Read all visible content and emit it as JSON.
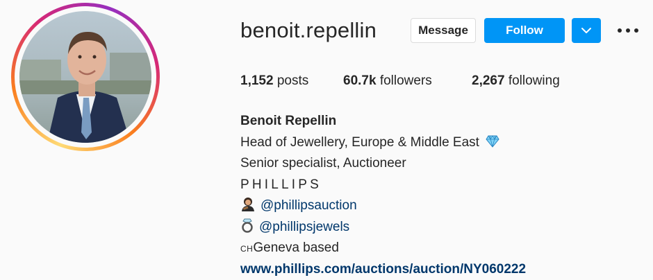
{
  "profile": {
    "username": "benoit.repellin",
    "stats": {
      "posts_count": "1,152",
      "posts_label": "posts",
      "followers_count": "60.7k",
      "followers_label": "followers",
      "following_count": "2,267",
      "following_label": "following"
    },
    "bio": {
      "full_name": "Benoit Repellin",
      "line1": "Head of Jewellery, Europe & Middle East",
      "line2": "Senior specialist, Auctioneer",
      "line3": "PHILLIPS",
      "mention1": "@phillipsauction",
      "mention2": "@phillipsjewels",
      "line6_prefix": "CH",
      "line6_text": "Geneva based",
      "website": "www.phillips.com/auctions/auction/NY060222"
    }
  },
  "actions": {
    "message_label": "Message",
    "follow_label": "Follow"
  },
  "colors": {
    "primary_blue": "#0095f6",
    "link_blue": "#00376b",
    "text": "#262626"
  },
  "icons": [
    "chevron-down-icon",
    "more-options-icon",
    "gem-icon",
    "judge-icon",
    "ring-icon"
  ]
}
